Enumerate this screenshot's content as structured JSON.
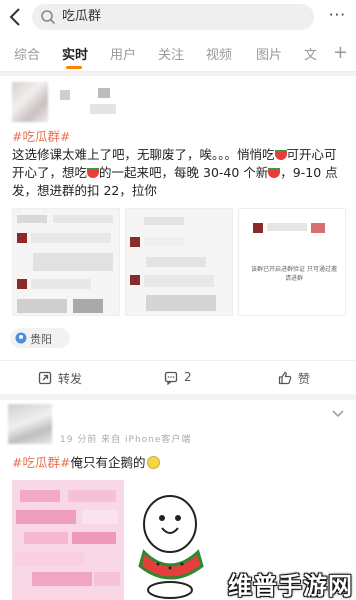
{
  "header": {
    "search_query": "吃瓜群",
    "more_label": "···"
  },
  "tabs": [
    {
      "label": "综合"
    },
    {
      "label": "实时"
    },
    {
      "label": "用户"
    },
    {
      "label": "关注"
    },
    {
      "label": "视频"
    },
    {
      "label": "图片"
    },
    {
      "label": "文"
    }
  ],
  "tabs_plus": "+",
  "post1": {
    "hashtag": "#吃瓜群#",
    "text_a": "这选修课太难上了吧，无聊废了，唉。。。悄悄吃",
    "text_b": "可开心可开心了，想吃",
    "text_c": "的一起来吧，每晚 30-40 个新",
    "text_d": "，9-10 点发，想进群的扣 22，拉你",
    "notice_text": "该群已开启进群验证 只可通过邀请进群",
    "location": "贵阳",
    "actions": {
      "repost": "转发",
      "comment": "2",
      "like": "赞"
    }
  },
  "post2": {
    "meta": "19 分前  来自 iPhone客户端",
    "hashtag": "#吃瓜群#",
    "text": "俺只有企鹅的"
  },
  "watermark": "维普手游网",
  "colors": {
    "accent": "#ff8200",
    "hashtag": "#eb7350"
  }
}
